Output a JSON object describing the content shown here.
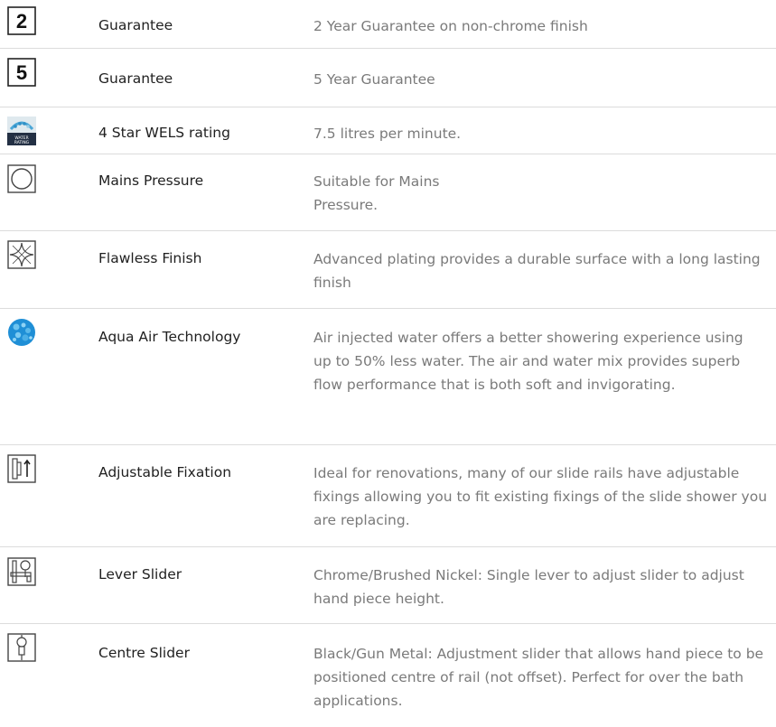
{
  "features": [
    {
      "icon": "number-2-icon",
      "icon_text": "2",
      "label": "Guarantee",
      "description": "2 Year Guarantee on non-chrome finish"
    },
    {
      "icon": "number-5-icon",
      "icon_text": "5",
      "label": "Guarantee",
      "description": "5 Year Guarantee"
    },
    {
      "icon": "wels-water-rating-icon",
      "icon_text": "WATER RATING",
      "label": "4 Star WELS rating",
      "description": "7.5 litres per minute."
    },
    {
      "icon": "mains-pressure-circle-icon",
      "label": "Mains Pressure",
      "description": "Suitable for Mains\nPressure."
    },
    {
      "icon": "sparkle-star-icon",
      "label": "Flawless Finish",
      "description": "Advanced plating provides a durable surface with a long lasting finish"
    },
    {
      "icon": "aqua-air-bubbles-icon",
      "label": "Aqua Air Technology",
      "description": "Air injected water offers a better showering experience using up to 50% less water. The air and water mix provides superb flow performance that is both soft and invigorating."
    },
    {
      "icon": "adjustable-fixation-icon",
      "label": "Adjustable Fixation",
      "description": "Ideal for renovations, many of our slide rails have adjustable fixings allowing you to fit existing fixings of the slide shower you are replacing."
    },
    {
      "icon": "lever-slider-icon",
      "label": "Lever Slider",
      "description": "Chrome/Brushed Nickel: Single lever to adjust slider to adjust hand piece height."
    },
    {
      "icon": "centre-slider-icon",
      "label": "Centre Slider",
      "description": "Black/Gun Metal: Adjustment slider that allows hand piece to be positioned centre of rail (not offset). Perfect for over the bath applications."
    }
  ]
}
